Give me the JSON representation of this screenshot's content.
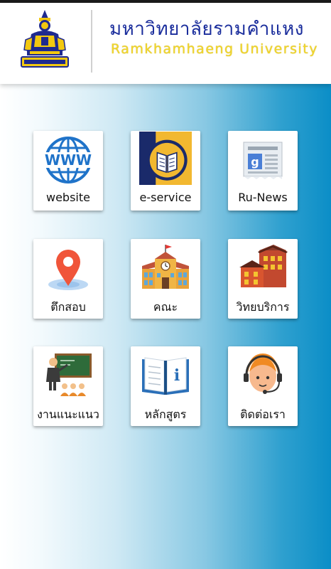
{
  "header": {
    "title_th": "มหาวิทยาลัยรามคำแหง",
    "title_en": "Ramkhamhaeng University",
    "logo_icon": "university-seal-icon"
  },
  "menu": [
    {
      "label": "website",
      "icon": "www-globe-icon"
    },
    {
      "label": "e-service",
      "icon": "e-service-book-icon"
    },
    {
      "label": "Ru-News",
      "icon": "newspaper-icon"
    },
    {
      "label": "ตึกสอบ",
      "icon": "map-pin-icon"
    },
    {
      "label": "คณะ",
      "icon": "school-building-icon"
    },
    {
      "label": "วิทยบริการ",
      "icon": "buildings-icon"
    },
    {
      "label": "งานแนะแนว",
      "icon": "teacher-classroom-icon"
    },
    {
      "label": "หลักสูตร",
      "icon": "info-book-icon"
    },
    {
      "label": "ติดต่อเรา",
      "icon": "support-agent-icon"
    }
  ],
  "colors": {
    "title_th": "#1a2d9c",
    "title_en": "#f1d62a",
    "gradient_end": "#0b8ec7"
  }
}
